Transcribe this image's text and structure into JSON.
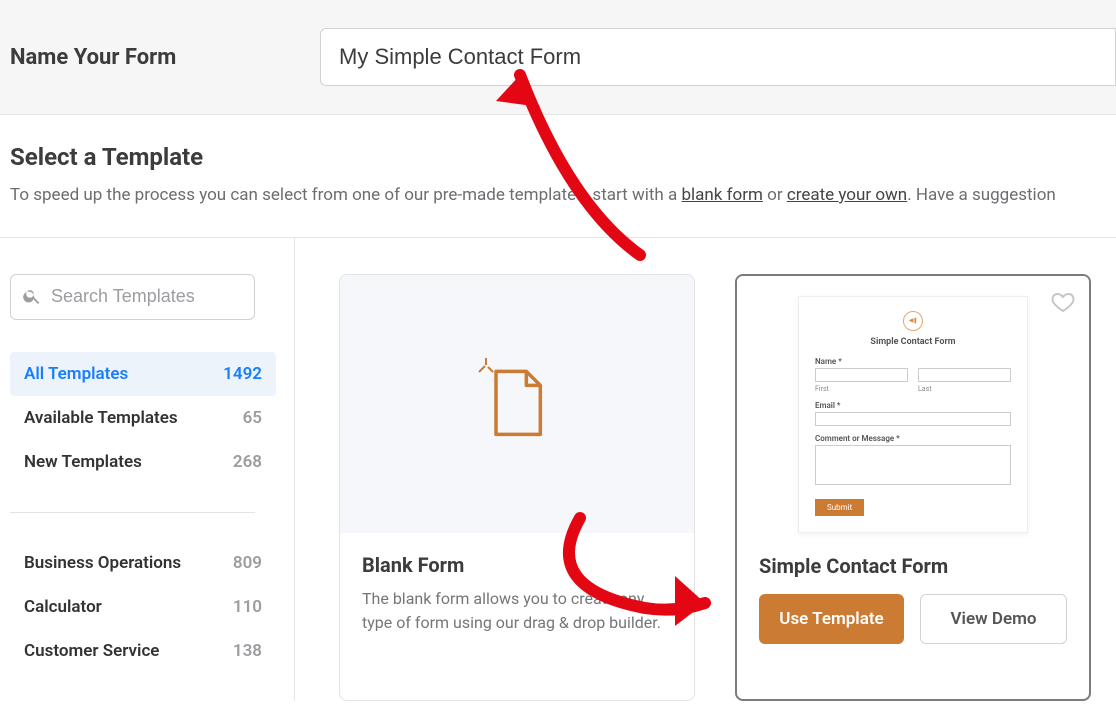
{
  "header": {
    "label": "Name Your Form",
    "form_name_value": "My Simple Contact Form"
  },
  "section": {
    "title": "Select a Template",
    "desc_prefix": "To speed up the process you can select from one of our pre-made templates, start with a ",
    "desc_link1": "blank form",
    "desc_mid": " or ",
    "desc_link2": "create your own",
    "desc_suffix": ". Have a suggestion"
  },
  "search_placeholder": "Search Templates",
  "filters": [
    {
      "label": "All Templates",
      "count": "1492"
    },
    {
      "label": "Available Templates",
      "count": "65"
    },
    {
      "label": "New Templates",
      "count": "268"
    }
  ],
  "categories": [
    {
      "label": "Business Operations",
      "count": "809"
    },
    {
      "label": "Calculator",
      "count": "110"
    },
    {
      "label": "Customer Service",
      "count": "138"
    }
  ],
  "cards": {
    "blank": {
      "title": "Blank Form",
      "desc": "The blank form allows you to create any type of form using our drag & drop builder."
    },
    "simple": {
      "title": "Simple Contact Form",
      "use_label": "Use Template",
      "demo_label": "View Demo",
      "preview": {
        "title": "Simple Contact Form",
        "name_label": "Name *",
        "first": "First",
        "last": "Last",
        "email_label": "Email *",
        "msg_label": "Comment or Message *",
        "submit": "Submit"
      }
    }
  }
}
